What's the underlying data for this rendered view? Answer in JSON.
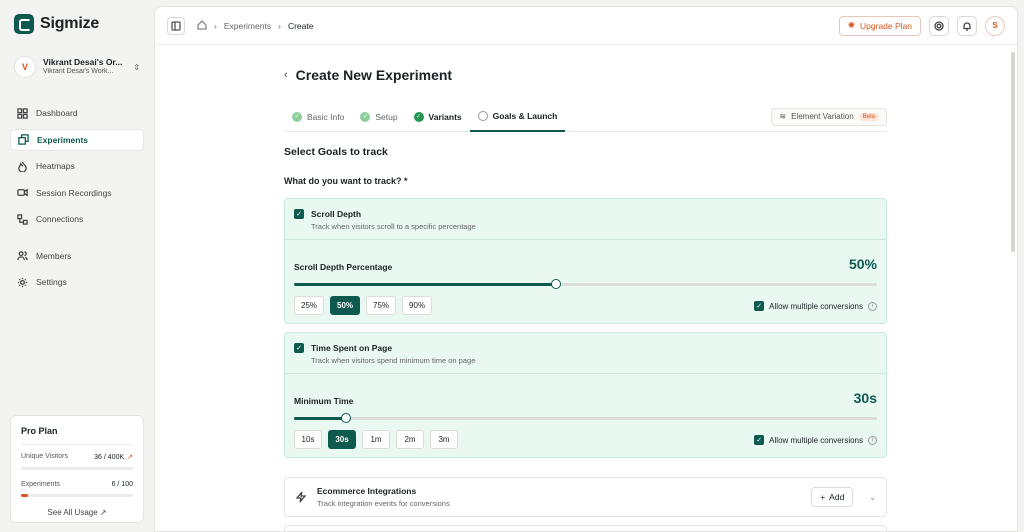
{
  "app": {
    "name": "Sigmize"
  },
  "org": {
    "avatar": "V",
    "name": "Vikrant Desai's Or...",
    "sub": "Vikrant Desai's Work..."
  },
  "nav": {
    "items": [
      {
        "label": "Dashboard",
        "icon": "grid-icon"
      },
      {
        "label": "Experiments",
        "icon": "experiments-icon",
        "active": true
      },
      {
        "label": "Heatmaps",
        "icon": "flame-icon"
      },
      {
        "label": "Session Recordings",
        "icon": "video-icon"
      },
      {
        "label": "Connections",
        "icon": "connections-icon"
      }
    ],
    "secondary": [
      {
        "label": "Members",
        "icon": "users-icon"
      },
      {
        "label": "Settings",
        "icon": "gear-icon"
      }
    ]
  },
  "plan": {
    "title": "Pro Plan",
    "visitors_label": "Unique Visitors",
    "visitors_value": "36 / 400K",
    "visitors_fraction": 0.0001,
    "experiments_label": "Experiments",
    "experiments_value": "6 / 100",
    "experiments_fraction": 0.06,
    "see_all": "See All Usage ↗"
  },
  "breadcrumb": {
    "items": [
      "Experiments",
      "Create"
    ]
  },
  "header": {
    "upgrade": "Upgrade Plan",
    "user_avatar": "S"
  },
  "page": {
    "title": "Create New Experiment"
  },
  "tabs": [
    {
      "label": "Basic Info",
      "state": "done-light"
    },
    {
      "label": "Setup",
      "state": "done-light"
    },
    {
      "label": "Variants",
      "state": "done"
    },
    {
      "label": "Goals & Launch",
      "state": "active"
    }
  ],
  "element_variation": {
    "label": "Element Variation",
    "badge": "Beta"
  },
  "section": {
    "title": "Select Goals to track",
    "question": "What do you want to track? *"
  },
  "goals": [
    {
      "title": "Scroll Depth",
      "desc": "Track when visitors scroll to a specific percentage",
      "metric_label": "Scroll Depth Percentage",
      "metric_value": "50%",
      "slider_fraction": 0.45,
      "presets": [
        "25%",
        "50%",
        "75%",
        "90%"
      ],
      "selected": "50%",
      "multi_label": "Allow multiple conversions"
    },
    {
      "title": "Time Spent on Page",
      "desc": "Track when visitors spend minimum time on page",
      "metric_label": "Minimum Time",
      "metric_value": "30s",
      "slider_fraction": 0.09,
      "presets": [
        "10s",
        "30s",
        "1m",
        "2m",
        "3m"
      ],
      "selected": "30s",
      "multi_label": "Allow multiple conversions"
    }
  ],
  "integrations": {
    "title": "Ecommerce Integrations",
    "desc": "Track integration events for conversions",
    "add": "Add"
  },
  "colors": {
    "brand": "#0e5a4f",
    "accent": "#d9541e",
    "card_bg": "#e9f8f1"
  }
}
